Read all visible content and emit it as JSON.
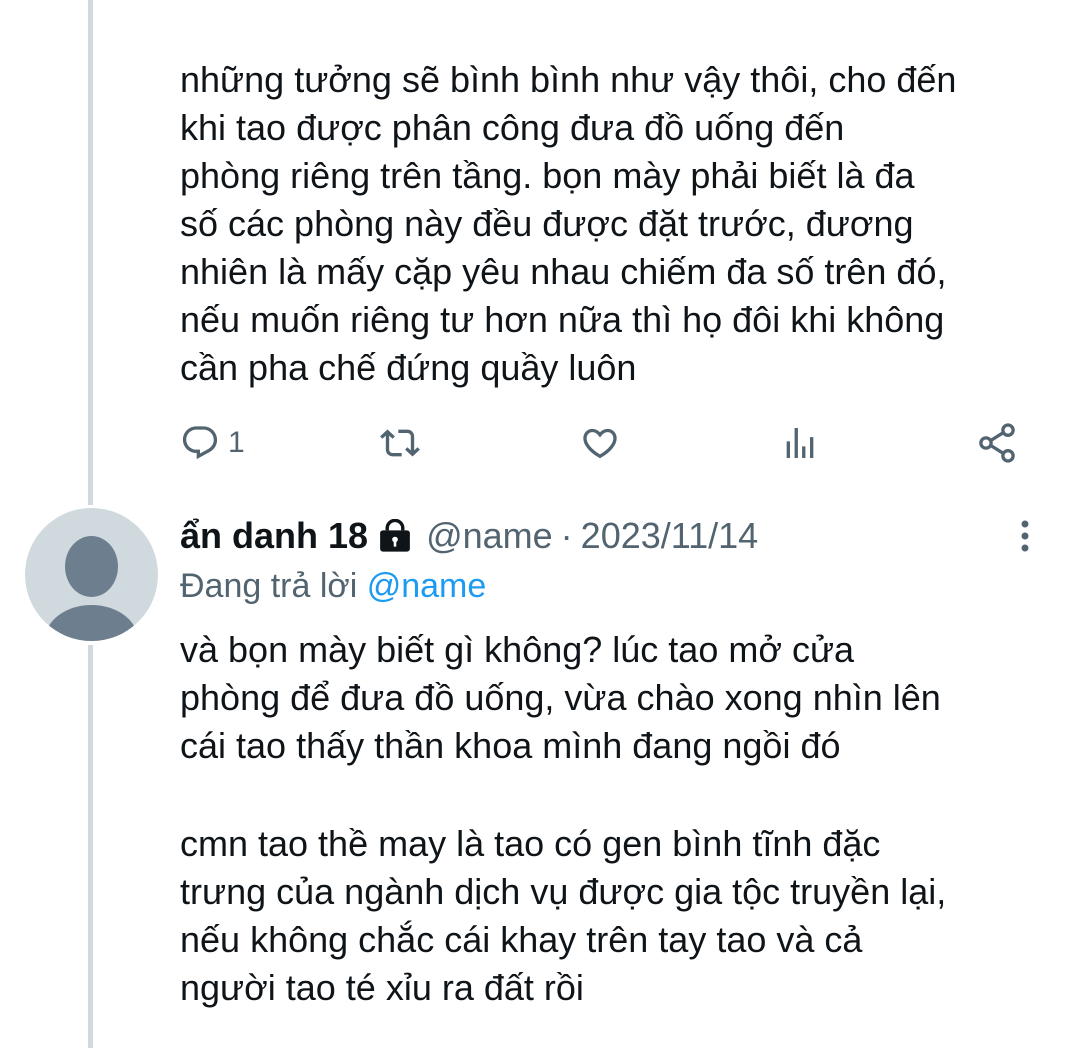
{
  "post1": {
    "text": "những tưởng sẽ bình bình như vậy thôi, cho đến\nkhi tao được phân công đưa đồ uống đến\nphòng riêng trên tầng. bọn mày phải biết là đa\nsố các phòng này đều được đặt trước, đương\nnhiên là mấy cặp yêu nhau chiếm đa số trên đó,\nnếu muốn riêng tư hơn nữa thì họ đôi khi không\ncần pha chế đứng quầy luôn",
    "actions": {
      "reply_count": "1",
      "reply_icon": "reply-icon",
      "retweet_icon": "retweet-icon",
      "like_icon": "heart-icon",
      "views_icon": "views-icon",
      "share_icon": "share-icon"
    }
  },
  "post2": {
    "display_name": "ẩn danh 18",
    "handle": "@name",
    "separator": "·",
    "date": "2023/11/14",
    "replying_prefix": "Đang trả lời ",
    "replying_to": "@name",
    "paragraphs": [
      "và bọn mày biết gì không? lúc tao mở cửa\nphòng để đưa đồ uống, vừa chào xong nhìn lên\ncái tao thấy thần khoa mình đang ngồi đó",
      "cmn tao thề may là tao có gen bình tĩnh đặc\ntrưng của ngành dịch vụ được gia tộc truyền lại,\nnếu không chắc cái khay trên tay tao và cả\nngười tao té xỉu ra đất rồi"
    ]
  },
  "colors": {
    "text_primary": "#0f1419",
    "text_secondary": "#536471",
    "accent": "#1d9bf0",
    "thread_line": "#cfd9de",
    "avatar_bg": "#cfd9de",
    "avatar_fg": "#6d7f8f"
  }
}
